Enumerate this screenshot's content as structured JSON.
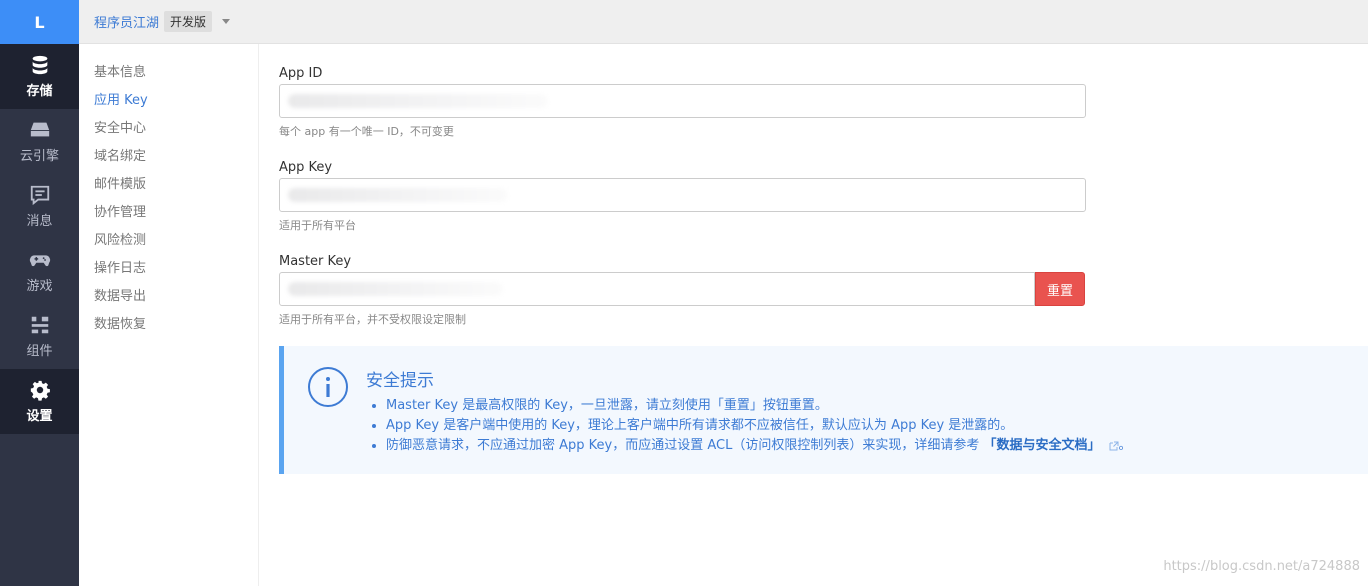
{
  "nav": {
    "logo": "L",
    "items": [
      {
        "label": "存储",
        "icon": "database-icon",
        "active": true
      },
      {
        "label": "云引擎",
        "icon": "server-icon",
        "active": false
      },
      {
        "label": "消息",
        "icon": "message-icon",
        "active": false
      },
      {
        "label": "游戏",
        "icon": "gamepad-icon",
        "active": false
      },
      {
        "label": "组件",
        "icon": "components-icon",
        "active": false
      },
      {
        "label": "设置",
        "icon": "gear-icon",
        "active": true
      }
    ]
  },
  "topbar": {
    "app_name": "程序员江湖",
    "env_badge": "开发版"
  },
  "subnav": {
    "items": [
      "基本信息",
      "应用 Key",
      "安全中心",
      "域名绑定",
      "邮件模版",
      "协作管理",
      "风险检测",
      "操作日志",
      "数据导出",
      "数据恢复"
    ],
    "active_index": 1
  },
  "fields": {
    "app_id": {
      "label": "App ID",
      "help": "每个 app 有一个唯一 ID，不可变更"
    },
    "app_key": {
      "label": "App Key",
      "help": "适用于所有平台"
    },
    "master_key": {
      "label": "Master Key",
      "help": "适用于所有平台，并不受权限设定限制",
      "button": "重置"
    }
  },
  "notice": {
    "title": "安全提示",
    "items": [
      "Master Key 是最高权限的 Key，一旦泄露，请立刻使用「重置」按钮重置。",
      "App Key 是客户端中使用的 Key，理论上客户端中所有请求都不应被信任，默认应认为 App Key 是泄露的。",
      "防御恶意请求，不应通过加密 App Key，而应通过设置 ACL（访问权限控制列表）来实现，详细请参考"
    ],
    "link": "「数据与安全文档」",
    "link_suffix": "。"
  },
  "colors": {
    "accent": "#3d7bd4",
    "sidebar": "#2f3445",
    "danger": "#e9534f",
    "logo_bg": "#3d8ef7"
  },
  "watermark": "https://blog.csdn.net/a724888"
}
